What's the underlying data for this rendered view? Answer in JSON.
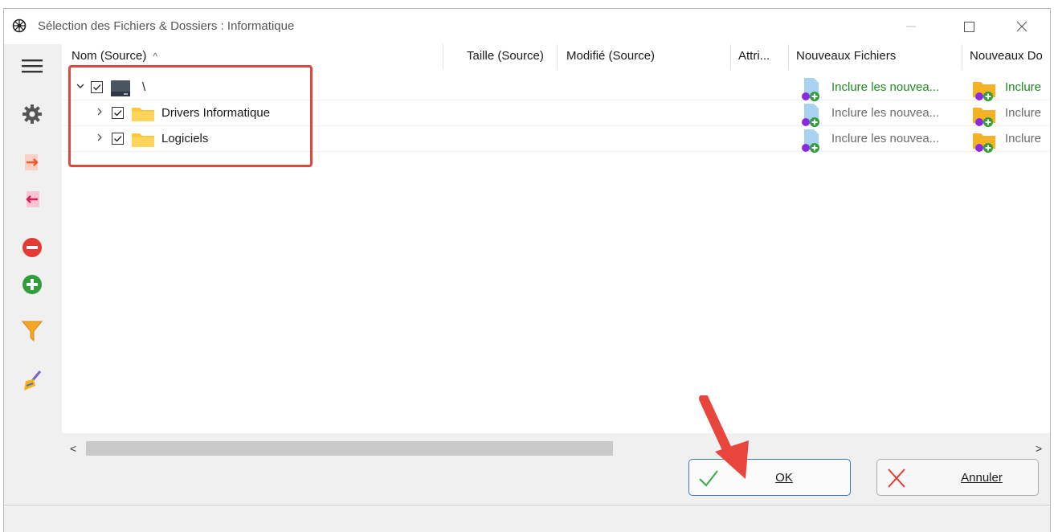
{
  "window": {
    "title": "Sélection des Fichiers & Dossiers : Informatique"
  },
  "columns": {
    "name": "Nom (Source)",
    "size": "Taille (Source)",
    "modified": "Modifié (Source)",
    "attr": "Attri...",
    "new_files": "Nouveaux Fichiers",
    "new_folders": "Nouveaux Do"
  },
  "rows": [
    {
      "name": "\\",
      "checked": true,
      "expanded": true,
      "type": "drive",
      "new_files": "Inclure les nouvea...",
      "new_folders": "Inclure",
      "highlight": true
    },
    {
      "name": "Drivers Informatique",
      "checked": true,
      "expanded": false,
      "type": "folder",
      "new_files": "Inclure les nouvea...",
      "new_folders": "Inclure",
      "highlight": false
    },
    {
      "name": "Logiciels",
      "checked": true,
      "expanded": false,
      "type": "folder",
      "new_files": "Inclure les nouvea...",
      "new_folders": "Inclure",
      "highlight": false
    }
  ],
  "toolbar_icons": [
    "menu-icon",
    "gear-icon",
    "arrow-right-icon",
    "arrow-left-icon",
    "minus-circle-icon",
    "plus-circle-icon",
    "filter-icon",
    "broom-icon"
  ],
  "buttons": {
    "ok": "OK",
    "cancel": "Annuler"
  },
  "colors": {
    "highlight_green": "#1e8a1e",
    "gray_text": "#6b6b6b",
    "annotation_red": "#e0453e",
    "ok_border": "#3b78c4"
  }
}
